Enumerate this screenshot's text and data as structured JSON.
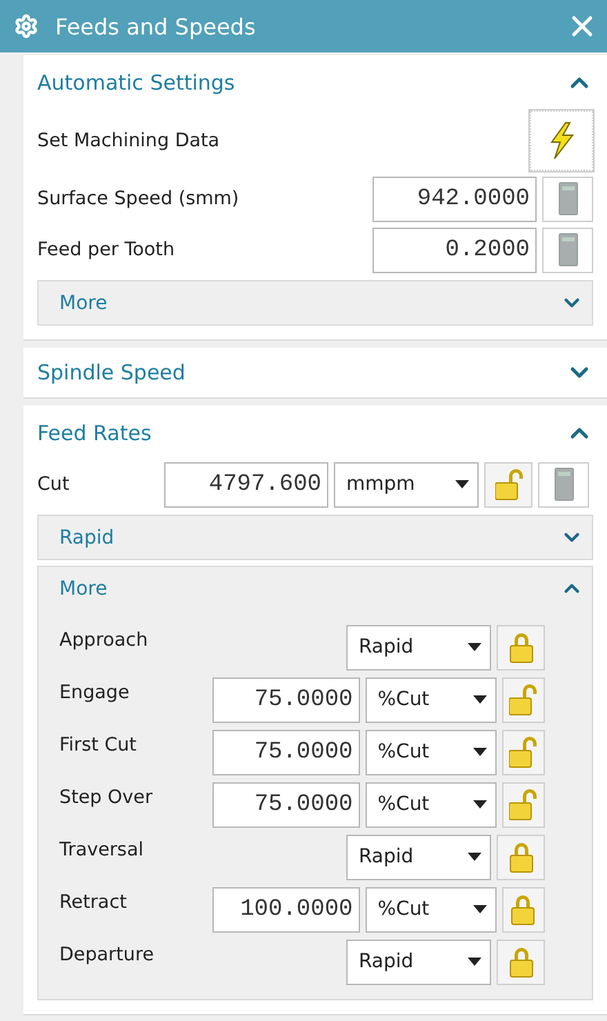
{
  "window": {
    "title": "Feeds and Speeds"
  },
  "sections": [
    {
      "title": "Automatic Settings",
      "expanded": true,
      "rows": [
        {
          "kind": "action",
          "label": "Set Machining Data"
        },
        {
          "kind": "value",
          "label": "Surface Speed (smm)",
          "value": "942.0000"
        },
        {
          "kind": "value",
          "label": "Feed per Tooth",
          "value": "0.2000"
        }
      ],
      "subsections": [
        {
          "title": "More",
          "expanded": false
        }
      ]
    },
    {
      "title": "Spindle Speed",
      "expanded": false
    },
    {
      "title": "Feed Rates",
      "expanded": true,
      "rows": [
        {
          "kind": "feed",
          "label": "Cut",
          "value": "4797.600",
          "unit": "mmpm",
          "locked": false
        }
      ],
      "subsections": [
        {
          "title": "Rapid",
          "expanded": false
        },
        {
          "title": "More",
          "expanded": true,
          "rows": [
            {
              "kind": "rate",
              "label": "Approach",
              "unit": "Rapid",
              "locked": true
            },
            {
              "kind": "rate",
              "label": "Engage",
              "value": "75.0000",
              "unit": "%Cut",
              "locked": false
            },
            {
              "kind": "rate",
              "label": "First Cut",
              "value": "75.0000",
              "unit": "%Cut",
              "locked": false
            },
            {
              "kind": "rate",
              "label": "Step Over",
              "value": "75.0000",
              "unit": "%Cut",
              "locked": false
            },
            {
              "kind": "rate",
              "label": "Traversal",
              "unit": "Rapid",
              "locked": true
            },
            {
              "kind": "rate",
              "label": "Retract",
              "value": "100.0000",
              "unit": "%Cut",
              "locked": true
            },
            {
              "kind": "rate",
              "label": "Departure",
              "unit": "Rapid",
              "locked": true
            }
          ]
        }
      ]
    }
  ]
}
